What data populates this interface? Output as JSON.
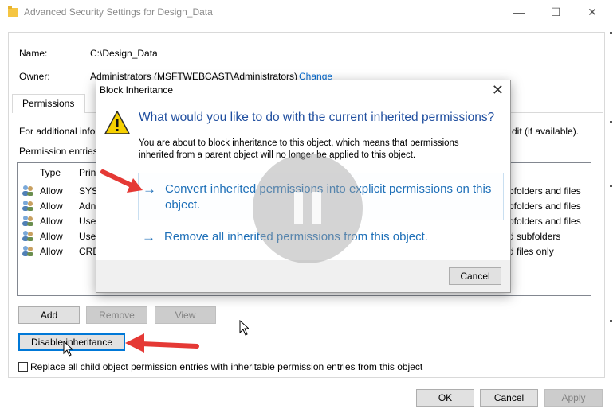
{
  "window": {
    "title": "Advanced Security Settings for Design_Data",
    "minimize": "—",
    "maximize": "☐",
    "close": "✕"
  },
  "header": {
    "name_label": "Name:",
    "name_value": "C:\\Design_Data",
    "owner_label": "Owner:",
    "owner_value": "Administrators (MSFTWEBCAST\\Administrators)",
    "owner_change": "Change"
  },
  "tabs": [
    {
      "label": "Permissions"
    }
  ],
  "info": {
    "additional_prefix": "For additional info",
    "additional_suffix": "dit (if available).",
    "entries_label": "Permission entries"
  },
  "list": {
    "columns": [
      "Type",
      "Prin"
    ],
    "rows": [
      {
        "type": "Allow",
        "principal": "SYS",
        "applies": "bfolders and files"
      },
      {
        "type": "Allow",
        "principal": "Adn",
        "applies": "bfolders and files"
      },
      {
        "type": "Allow",
        "principal": "Use",
        "applies": "bfolders and files"
      },
      {
        "type": "Allow",
        "principal": "Use",
        "applies": "d subfolders"
      },
      {
        "type": "Allow",
        "principal": "CRE",
        "applies": "d files only"
      }
    ]
  },
  "buttons": {
    "add": "Add",
    "remove": "Remove",
    "view": "View",
    "disable_inheritance": "Disable inheritance",
    "ok": "OK",
    "cancel": "Cancel",
    "apply": "Apply"
  },
  "replace_checkbox_label": "Replace all child object permission entries with inheritable permission entries from this object",
  "dialog": {
    "title": "Block Inheritance",
    "close": "✕",
    "heading": "What would you like to do with the current inherited permissions?",
    "body": "You are about to block inheritance to this object, which means that permissions inherited from a parent object will no longer be applied to this object.",
    "option1": "Convert inherited permissions into explicit permissions on this object.",
    "option2": "Remove all inherited permissions from this object.",
    "cancel": "Cancel",
    "arrow_glyph": "→"
  },
  "colors": {
    "accent_blue": "#1d6fb8",
    "heading_blue": "#1f4e9f",
    "annotation_red": "#e53935",
    "focus_blue": "#0078d7"
  },
  "icons": [
    "folder-icon",
    "users-icon",
    "warning-icon",
    "arrow-right-icon",
    "pause-icon",
    "cursor-icon"
  ]
}
